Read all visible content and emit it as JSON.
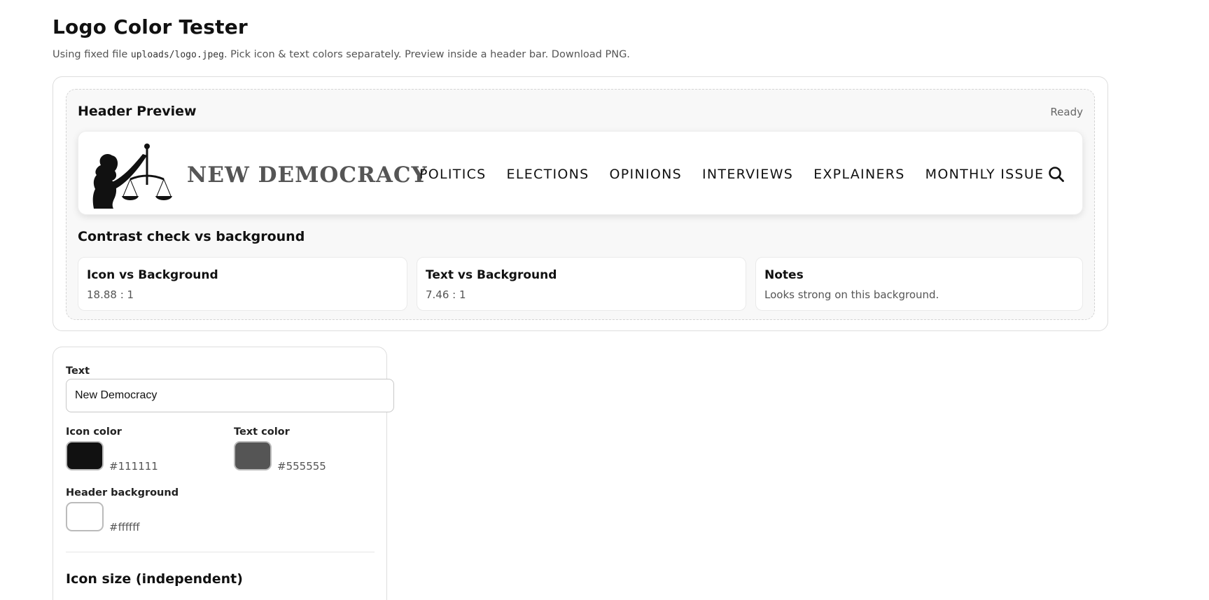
{
  "page": {
    "title": "Logo Color Tester",
    "subtitle_prefix": "Using fixed file ",
    "subtitle_file": "uploads/logo.jpeg",
    "subtitle_suffix": ". Pick icon & text colors separately. Preview inside a header bar. Download PNG."
  },
  "preview": {
    "title": "Header Preview",
    "status": "Ready",
    "logo_text": "NEW DEMOCRACY",
    "nav_items": [
      "POLITICS",
      "ELECTIONS",
      "OPINIONS",
      "INTERVIEWS",
      "EXPLAINERS",
      "MONTHLY ISSUE"
    ],
    "search_icon": "search-icon",
    "logo_icon": "scales-of-justice-icon"
  },
  "contrast": {
    "title": "Contrast check vs background",
    "cards": [
      {
        "title": "Icon vs Background",
        "value": "18.88 : 1"
      },
      {
        "title": "Text vs Background",
        "value": "7.46 : 1"
      },
      {
        "title": "Notes",
        "value": "Looks strong on this background."
      }
    ]
  },
  "controls": {
    "text_label": "Text",
    "text_value": "New Democracy",
    "icon_color_label": "Icon color",
    "icon_color": "#111111",
    "text_color_label": "Text color",
    "text_color": "#555555",
    "header_bg_label": "Header background",
    "header_bg": "#ffffff",
    "icon_size_heading": "Icon size (independent)"
  }
}
